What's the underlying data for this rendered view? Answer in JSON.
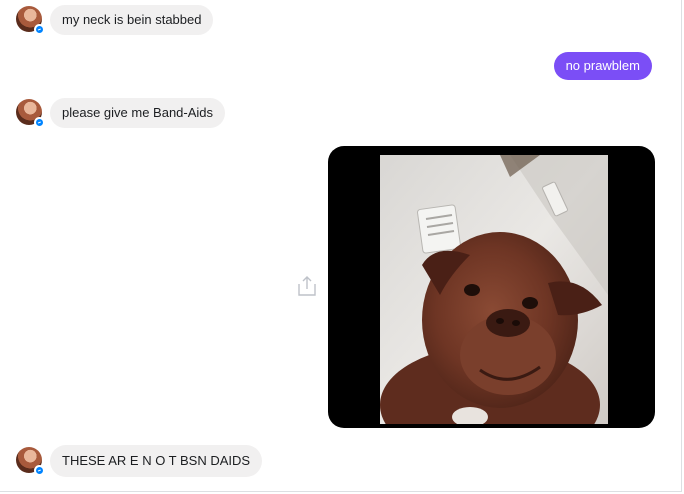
{
  "conversation": {
    "messages": [
      {
        "direction": "incoming",
        "text": "my neck is bein stabbed"
      },
      {
        "direction": "outgoing",
        "text": "no prawblem"
      },
      {
        "direction": "incoming",
        "text": "please give me Band-Aids"
      },
      {
        "direction": "outgoing",
        "type": "photo",
        "subject": "dog"
      },
      {
        "direction": "incoming",
        "text": "THESE AR E N O T BSN DAIDS"
      }
    ]
  },
  "colors": {
    "outgoing_bubble": "#7b4ef6",
    "incoming_bubble": "#f1f0f0",
    "messenger_badge": "#0084ff"
  },
  "icons": {
    "share": "share-icon",
    "badge": "messenger-badge-icon"
  }
}
